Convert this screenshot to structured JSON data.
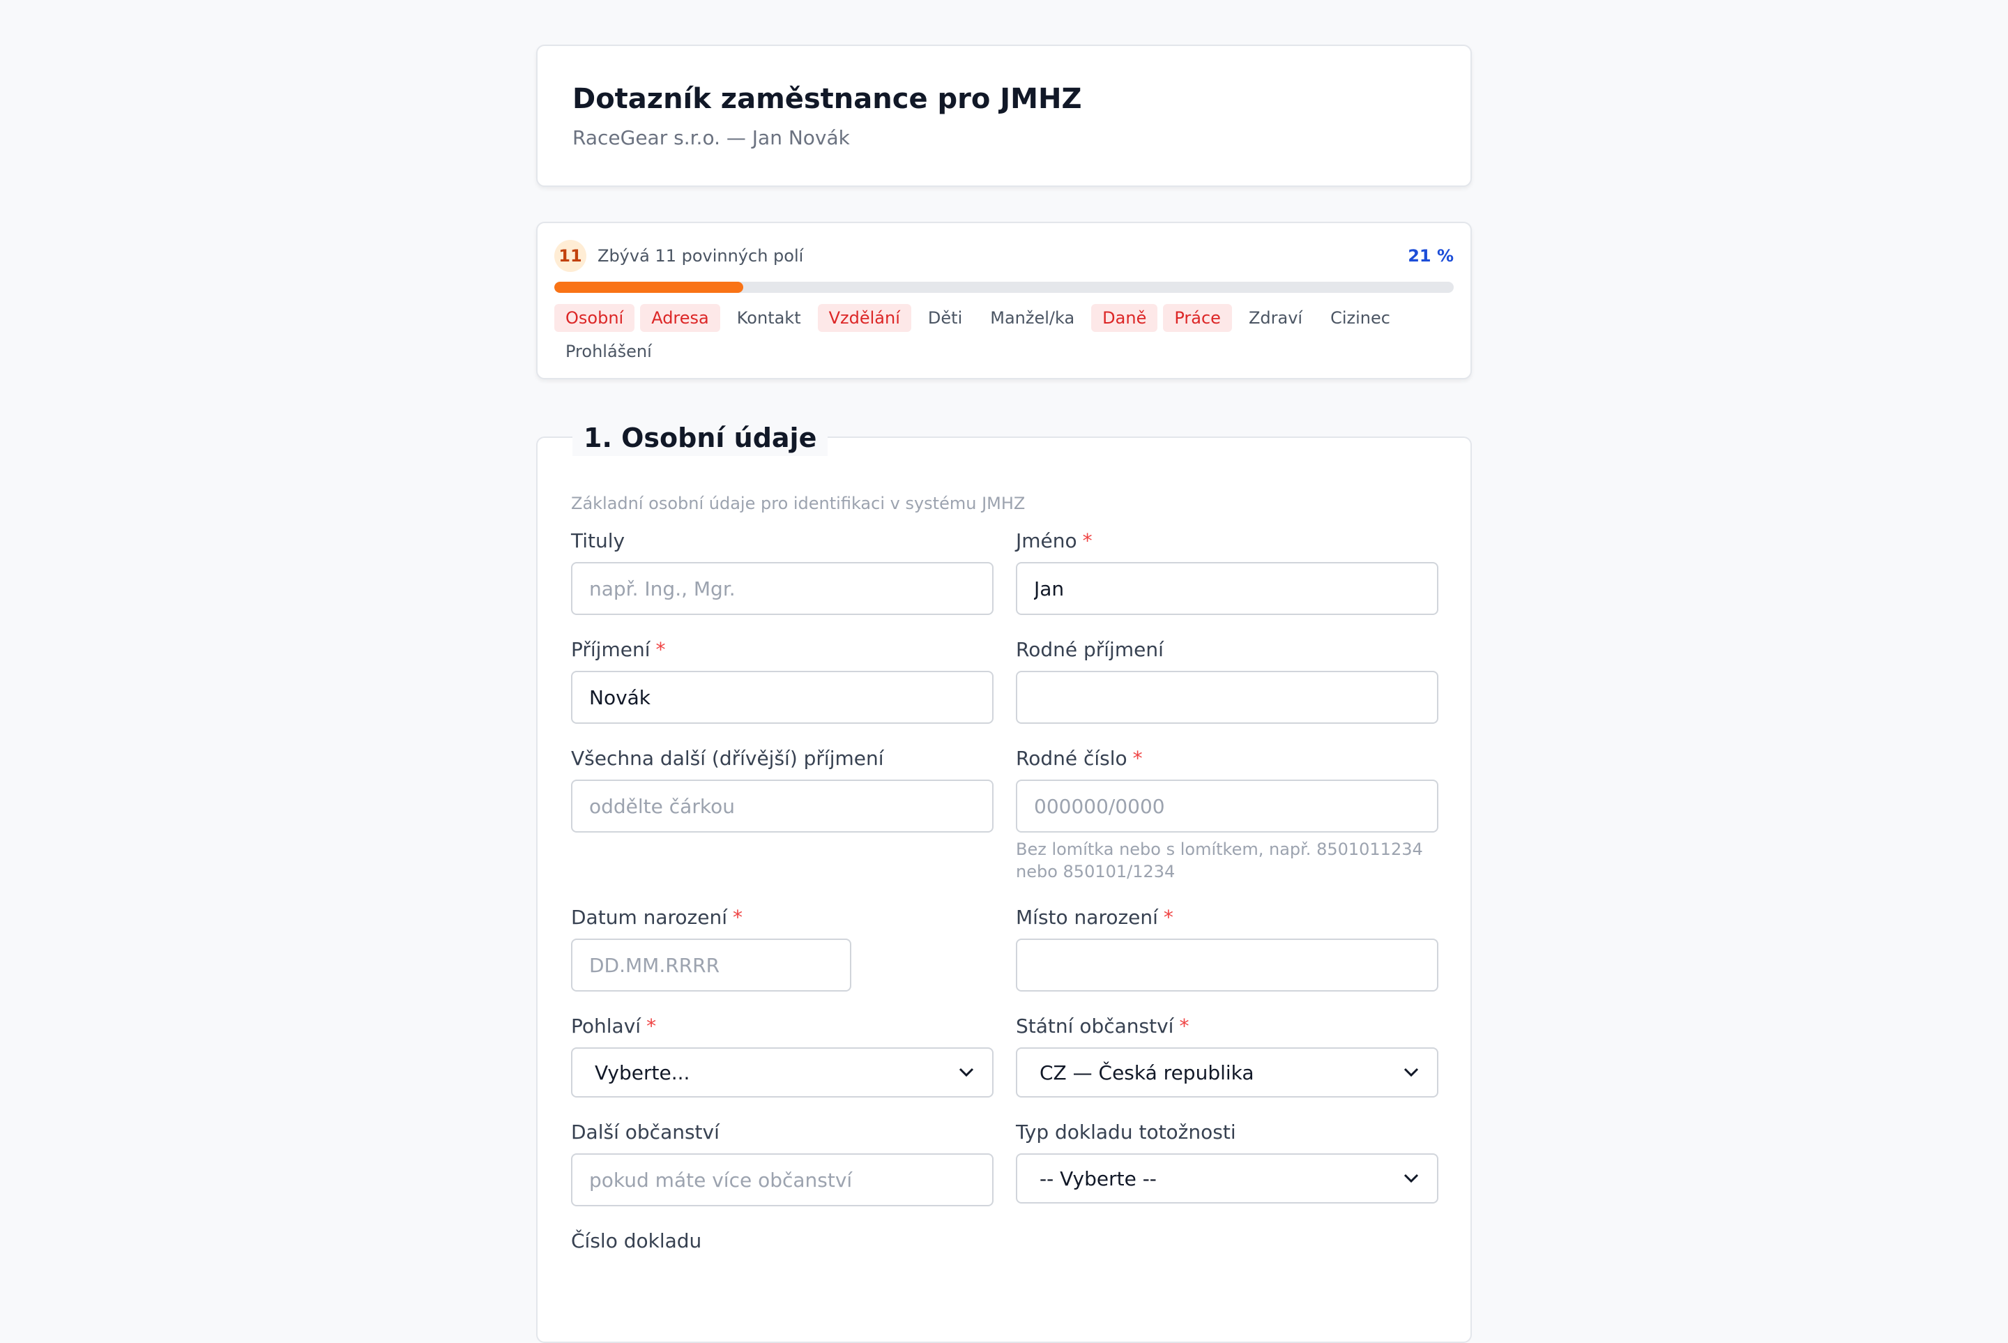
{
  "header": {
    "title": "Dotazník zaměstnance pro JMHZ",
    "subtitle": "RaceGear s.r.o. — Jan Novák"
  },
  "progress": {
    "remaining_count": "11",
    "remaining_text": "Zbývá 11 povinných polí",
    "percent_text": "21 %",
    "percent_value": 21,
    "tabs": [
      {
        "label": "Osobní",
        "incomplete": true
      },
      {
        "label": "Adresa",
        "incomplete": true
      },
      {
        "label": "Kontakt",
        "incomplete": false
      },
      {
        "label": "Vzdělání",
        "incomplete": true
      },
      {
        "label": "Děti",
        "incomplete": false
      },
      {
        "label": "Manžel/ka",
        "incomplete": false
      },
      {
        "label": "Daně",
        "incomplete": true
      },
      {
        "label": "Práce",
        "incomplete": true
      },
      {
        "label": "Zdraví",
        "incomplete": false
      },
      {
        "label": "Cizinec",
        "incomplete": false
      },
      {
        "label": "Prohlášení",
        "incomplete": false
      }
    ]
  },
  "section": {
    "title": "1. Osobní údaje",
    "description": "Základní osobní údaje pro identifikaci v systému JMHZ",
    "required_mark": "*",
    "fields": {
      "tituly": {
        "label": "Tituly",
        "value": "",
        "placeholder": "např. Ing., Mgr."
      },
      "jmeno": {
        "label": "Jméno",
        "value": "Jan",
        "placeholder": ""
      },
      "prijmeni": {
        "label": "Příjmení",
        "value": "Novák",
        "placeholder": ""
      },
      "rodne_prijmeni": {
        "label": "Rodné příjmení",
        "value": "",
        "placeholder": ""
      },
      "dalsi_prijmeni": {
        "label": "Všechna další (dřívější) příjmení",
        "value": "",
        "placeholder": "oddělte čárkou"
      },
      "rodne_cislo": {
        "label": "Rodné číslo",
        "value": "",
        "placeholder": "000000/0000",
        "hint": "Bez lomítka nebo s lomítkem, např. 8501011234 nebo 850101/1234"
      },
      "datum_narozeni": {
        "label": "Datum narození",
        "value": "",
        "placeholder": "DD.MM.RRRR"
      },
      "misto_narozeni": {
        "label": "Místo narození",
        "value": "",
        "placeholder": ""
      },
      "pohlavi": {
        "label": "Pohlaví",
        "selected": "Vyberte..."
      },
      "obcanstvi": {
        "label": "Státní občanství",
        "selected": "CZ — Česká republika"
      },
      "dalsi_obcanstvi": {
        "label": "Další občanství",
        "value": "",
        "placeholder": "pokud máte více občanství"
      },
      "typ_dokladu": {
        "label": "Typ dokladu totožnosti",
        "selected": "-- Vyberte --"
      },
      "cislo_dokladu": {
        "label": "Číslo dokladu"
      }
    }
  },
  "colors": {
    "accent_progress": "#f97316",
    "percent_text": "#1d4ed8",
    "incomplete_tab_bg": "#fde8e8",
    "incomplete_tab_text": "#dc2626",
    "required": "#ef4444"
  },
  "icons": {
    "select_arrow": "chevron-down-icon"
  }
}
